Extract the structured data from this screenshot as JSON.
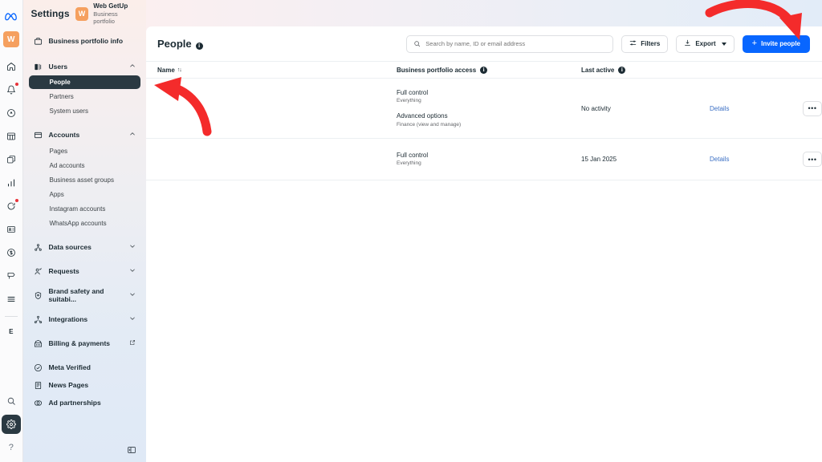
{
  "rail": {
    "brand_icon": "meta-logo",
    "avatar_letter": "W",
    "items": [
      {
        "name": "home-icon",
        "label": "Home"
      },
      {
        "name": "notifications-icon",
        "label": "Notifications",
        "badge": true
      },
      {
        "name": "account-quality-icon",
        "label": "Account Quality"
      },
      {
        "name": "billing-grid-icon",
        "label": "Billing"
      },
      {
        "name": "ads-manager-icon",
        "label": "Ads Manager"
      },
      {
        "name": "analytics-icon",
        "label": "Analytics"
      },
      {
        "name": "events-manager-icon",
        "label": "Events Manager",
        "badge": true
      },
      {
        "name": "audience-icon",
        "label": "Audiences"
      },
      {
        "name": "payments-icon",
        "label": "Payments"
      },
      {
        "name": "feedback-icon",
        "label": "Feedback"
      },
      {
        "name": "all-tools-icon",
        "label": "All tools"
      }
    ],
    "letter_item": "E",
    "search_label": "Search",
    "settings_label": "Settings",
    "help_label": "?"
  },
  "sidebar": {
    "title": "Settings",
    "portfolio": {
      "avatar_letter": "W",
      "name": "Web GetUp",
      "subtitle": "Business portfolio"
    },
    "groups": [
      {
        "label": "Business portfolio info",
        "icon": "briefcase-icon",
        "expandable": false,
        "children": []
      },
      {
        "label": "Users",
        "icon": "users-icon",
        "chevron": "up",
        "children": [
          {
            "label": "People",
            "active": true
          },
          {
            "label": "Partners",
            "active": false
          },
          {
            "label": "System users",
            "active": false
          }
        ]
      },
      {
        "label": "Accounts",
        "icon": "accounts-icon",
        "chevron": "up",
        "children": [
          {
            "label": "Pages",
            "active": false
          },
          {
            "label": "Ad accounts",
            "active": false
          },
          {
            "label": "Business asset groups",
            "active": false
          },
          {
            "label": "Apps",
            "active": false
          },
          {
            "label": "Instagram accounts",
            "active": false
          },
          {
            "label": "WhatsApp accounts",
            "active": false
          }
        ]
      },
      {
        "label": "Data sources",
        "icon": "data-sources-icon",
        "chevron": "down",
        "children": []
      },
      {
        "label": "Requests",
        "icon": "requests-icon",
        "chevron": "down",
        "children": []
      },
      {
        "label": "Brand safety and suitabi...",
        "icon": "shield-icon",
        "chevron": "down",
        "children": []
      },
      {
        "label": "Integrations",
        "icon": "integrations-icon",
        "chevron": "down",
        "children": []
      },
      {
        "label": "Billing & payments",
        "icon": "billing-icon",
        "external": true,
        "children": []
      },
      {
        "label": "Meta Verified",
        "icon": "verified-check-icon",
        "children": []
      },
      {
        "label": "News Pages",
        "icon": "news-pages-icon",
        "children": []
      },
      {
        "label": "Ad partnerships",
        "icon": "ad-partnerships-icon",
        "children": []
      }
    ],
    "collapse_icon": "collapse-panel-icon"
  },
  "header": {
    "page_title": "People",
    "info_glyph": "i",
    "search": {
      "placeholder": "Search by name, ID or email address",
      "value": "",
      "icon": "search-icon"
    },
    "filters_label": "Filters",
    "export_label": "Export",
    "invite_label": "Invite people",
    "invite_plus": "+",
    "accent_primary": "#0866ff"
  },
  "table": {
    "columns": [
      {
        "key": "name",
        "label": "Name",
        "sort_glyph": "↑↓",
        "info": false
      },
      {
        "key": "access",
        "label": "Business portfolio access",
        "info": true
      },
      {
        "key": "active",
        "label": "Last active",
        "info": true
      },
      {
        "key": "details",
        "label": "",
        "info": false
      },
      {
        "key": "menu",
        "label": "",
        "info": false
      }
    ],
    "rows": [
      {
        "name": "",
        "access": [
          {
            "title": "Full control",
            "sub": "Everything"
          },
          {
            "title": "Advanced options",
            "sub": "Finance (view and manage)"
          }
        ],
        "last_active": "No activity",
        "details_label": "Details",
        "menu_glyph": "•••"
      },
      {
        "name": "",
        "access": [
          {
            "title": "Full control",
            "sub": "Everything"
          }
        ],
        "last_active": "15 Jan 2025",
        "details_label": "Details",
        "menu_glyph": "•••"
      }
    ]
  },
  "annotations": {
    "arrow_color": "#f42b2b",
    "arrows": [
      {
        "name": "arrow-to-invite-people",
        "target": "Invite people"
      },
      {
        "name": "arrow-to-people-nav",
        "target": "People"
      }
    ]
  }
}
